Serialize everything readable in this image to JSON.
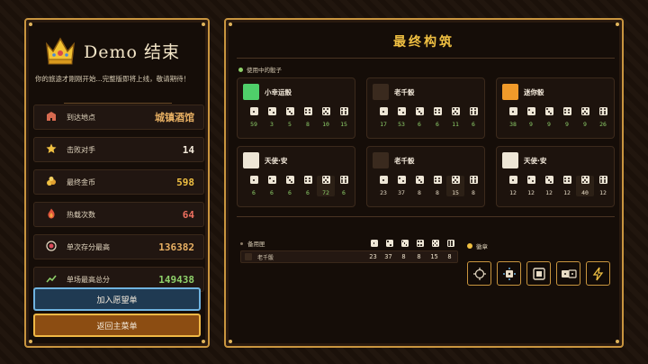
{
  "left": {
    "title": "Demo 结束",
    "description": "你的旅途才刚刚开始...完整版即将上线，敬请期待！",
    "stats": [
      {
        "label": "到达地点",
        "value": "城镇酒馆",
        "color": "#e8b063",
        "icon": "castle-icon"
      },
      {
        "label": "击败对手",
        "value": "14",
        "color": "#f4eadb",
        "icon": "star-icon"
      },
      {
        "label": "最终金币",
        "value": "598",
        "color": "#f0c042",
        "icon": "coins-icon"
      },
      {
        "label": "热载次数",
        "value": "64",
        "color": "#f07060",
        "icon": "flame-icon"
      },
      {
        "label": "单次存分最高",
        "value": "136382",
        "color": "#e8b063",
        "icon": "target-icon"
      },
      {
        "label": "单场最高总分",
        "value": "149438",
        "color": "#8ed06a",
        "icon": "chart-icon"
      }
    ],
    "wish_button": "加入愿望单",
    "menu_button": "返回主菜单"
  },
  "right": {
    "title": "最终构筑",
    "in_use_label": "使用中的骰子",
    "dice": [
      {
        "name": "小幸运骰",
        "values": [
          "59",
          "3",
          "5",
          "8",
          "10",
          "15"
        ],
        "value_color": "#8ed06a",
        "big_color": "#4fcf6a",
        "big_pips": 1,
        "big_dot": "#1a120c"
      },
      {
        "name": "老千骰",
        "values": [
          "17",
          "53",
          "6",
          "6",
          "11",
          "6"
        ],
        "value_color": "#8ed06a",
        "big_color": "#3a2a1e",
        "big_pips": 2,
        "big_dot": "#e0a040"
      },
      {
        "name": "迷你骰",
        "values": [
          "38",
          "9",
          "9",
          "9",
          "9",
          "26"
        ],
        "value_color": "#8ed06a",
        "big_color": "#f09a2a",
        "big_pips": 6,
        "big_dot": "#3a1a08"
      },
      {
        "name": "天使·安",
        "values": [
          "6",
          "6",
          "6",
          "6",
          "72",
          "6"
        ],
        "value_color": "#8ed06a",
        "big_color": "#eee6d6",
        "big_pips": 5,
        "big_dot": "#d0a030"
      },
      {
        "name": "老千骰",
        "values": [
          "23",
          "37",
          "8",
          "8",
          "15",
          "8"
        ],
        "value_color": "#e8dcc6",
        "big_color": "#3a2a1e",
        "big_pips": 2,
        "big_dot": "#e0a040"
      },
      {
        "name": "天使·安",
        "values": [
          "12",
          "12",
          "12",
          "12",
          "40",
          "12"
        ],
        "value_color": "#e8dcc6",
        "big_color": "#eee6d6",
        "big_pips": 5,
        "big_dot": "#d0a030"
      }
    ],
    "bench_label": "备用匣",
    "bench": [
      {
        "name": "老千骰",
        "values": [
          "23",
          "37",
          "8",
          "8",
          "15",
          "8"
        ]
      }
    ],
    "charm_label": "徽章",
    "charms": [
      "crosshair-icon",
      "dice-cluster-icon",
      "square-die-icon",
      "double-die-icon",
      "lightning-icon"
    ]
  }
}
